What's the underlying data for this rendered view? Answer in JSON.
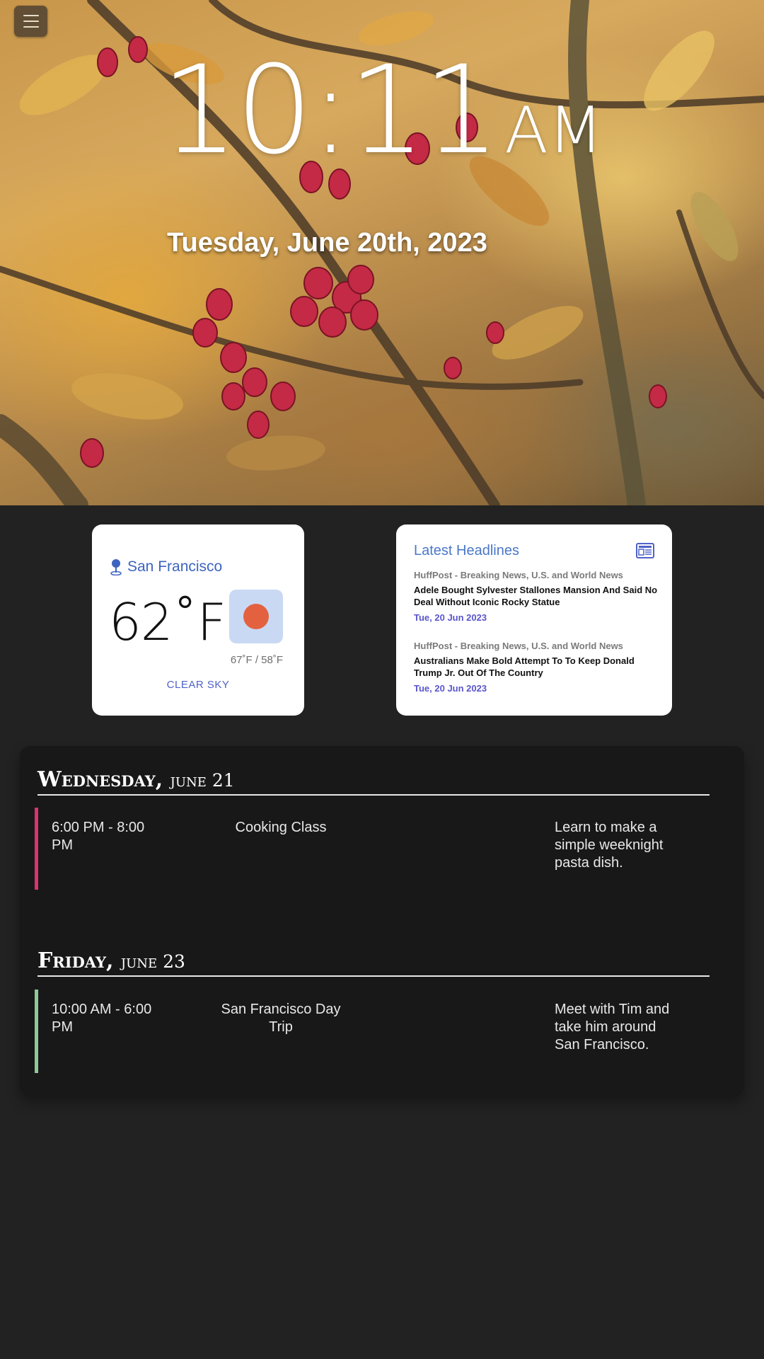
{
  "clock": {
    "time": "10:11",
    "ampm": "AM",
    "date": "Tuesday, June 20th, 2023"
  },
  "weather": {
    "location": "San Francisco",
    "temperature": "62˚F",
    "hi_lo": "67˚F / 58˚F",
    "description": "CLEAR SKY",
    "icon": "sun-icon"
  },
  "news": {
    "title": "Latest Headlines",
    "items": [
      {
        "source": "HuffPost - Breaking News, U.S. and World News",
        "headline": "Adele Bought Sylvester Stallones Mansion And Said No Deal Without Iconic Rocky Statue",
        "date": "Tue, 20 Jun 2023"
      },
      {
        "source": "HuffPost - Breaking News, U.S. and World News",
        "headline": "Australians Make Bold Attempt To To Keep Donald Trump Jr. Out Of The Country",
        "date": "Tue, 20 Jun 2023"
      }
    ]
  },
  "calendar": {
    "days": [
      {
        "weekday": "Wednesday",
        "date": "june 21",
        "events": [
          {
            "time": "6:00 PM - 8:00 PM",
            "title": "Cooking Class",
            "description": "Learn to make a simple weeknight pasta dish.",
            "color": "#d8346f"
          }
        ]
      },
      {
        "weekday": "Friday",
        "date": "june 23",
        "events": [
          {
            "time": "10:00 AM - 6:00 PM",
            "title": "San Francisco Day Trip",
            "description": "Meet with Tim and take him around San Francisco.",
            "color": "#8fc99a"
          }
        ]
      }
    ]
  }
}
